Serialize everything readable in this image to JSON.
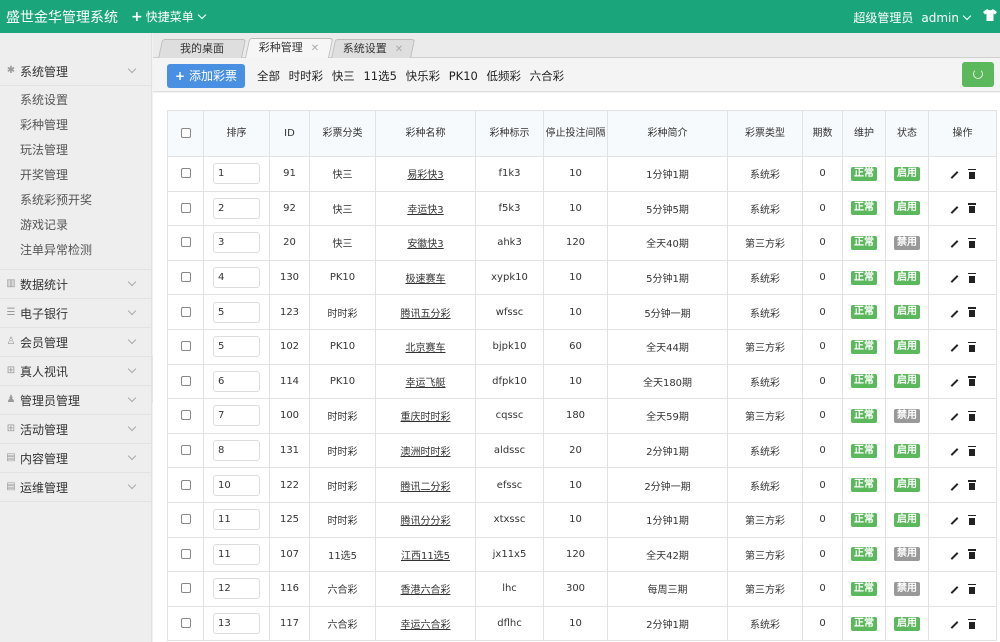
{
  "app": {
    "title": "盛世金华管理系统",
    "quick_menu": "快捷菜单",
    "user_role": "超级管理员",
    "user_name": "admin",
    "theme_icon": "shirt-icon",
    "accent_color": "#1aa67a"
  },
  "sidebar": {
    "groups": [
      {
        "label": "系统管理",
        "icon": "gear-icon",
        "expanded": true,
        "items": [
          "系统设置",
          "彩种管理",
          "玩法管理",
          "开奖管理",
          "系统彩预开奖",
          "游戏记录",
          "注单异常检测"
        ]
      },
      {
        "label": "数据统计",
        "icon": "chart-icon"
      },
      {
        "label": "电子银行",
        "icon": "list-icon"
      },
      {
        "label": "会员管理",
        "icon": "user-icon"
      },
      {
        "label": "真人视讯",
        "icon": "gift-icon"
      },
      {
        "label": "管理员管理",
        "icon": "admin-icon"
      },
      {
        "label": "活动管理",
        "icon": "gift-icon"
      },
      {
        "label": "内容管理",
        "icon": "content-icon"
      },
      {
        "label": "运维管理",
        "icon": "content-icon"
      }
    ]
  },
  "tabs": [
    {
      "label": "我的桌面",
      "closable": false,
      "active": false
    },
    {
      "label": "彩种管理",
      "closable": true,
      "active": true
    },
    {
      "label": "系统设置",
      "closable": true,
      "active": false
    }
  ],
  "toolbar": {
    "add_label": "添加彩票",
    "filters": [
      "全部",
      "时时彩",
      "快三",
      "11选5",
      "快乐彩",
      "PK10",
      "低频彩",
      "六合彩"
    ],
    "refresh_icon": "refresh-icon"
  },
  "table": {
    "headers": [
      "",
      "排序",
      "ID",
      "彩票分类",
      "彩种名称",
      "彩种标示",
      "停止投注间隔",
      "彩种简介",
      "彩票类型",
      "期数",
      "维护",
      "状态",
      "操作"
    ],
    "rows": [
      {
        "sort": "1",
        "id": "91",
        "category": "快三",
        "name": "易彩快3",
        "code": "f1k3",
        "interval": "10",
        "intro": "1分钟1期",
        "type": "系统彩",
        "periods": "0",
        "maintain": "正常",
        "status": "启用"
      },
      {
        "sort": "2",
        "id": "92",
        "category": "快三",
        "name": "幸运快3",
        "code": "f5k3",
        "interval": "10",
        "intro": "5分钟5期",
        "type": "系统彩",
        "periods": "0",
        "maintain": "正常",
        "status": "启用"
      },
      {
        "sort": "3",
        "id": "20",
        "category": "快三",
        "name": "安徽快3",
        "code": "ahk3",
        "interval": "120",
        "intro": "全天40期",
        "type": "第三方彩",
        "periods": "0",
        "maintain": "正常",
        "status": "禁用"
      },
      {
        "sort": "4",
        "id": "130",
        "category": "PK10",
        "name": "极速赛车",
        "code": "xypk10",
        "interval": "10",
        "intro": "5分钟1期",
        "type": "系统彩",
        "periods": "0",
        "maintain": "正常",
        "status": "启用"
      },
      {
        "sort": "5",
        "id": "123",
        "category": "时时彩",
        "name": "腾讯五分彩",
        "code": "wfssc",
        "interval": "10",
        "intro": "5分钟一期",
        "type": "系统彩",
        "periods": "0",
        "maintain": "正常",
        "status": "启用"
      },
      {
        "sort": "5",
        "id": "102",
        "category": "PK10",
        "name": "北京赛车",
        "code": "bjpk10",
        "interval": "60",
        "intro": "全天44期",
        "type": "第三方彩",
        "periods": "0",
        "maintain": "正常",
        "status": "启用"
      },
      {
        "sort": "6",
        "id": "114",
        "category": "PK10",
        "name": "幸运飞艇",
        "code": "dfpk10",
        "interval": "10",
        "intro": "全天180期",
        "type": "系统彩",
        "periods": "0",
        "maintain": "正常",
        "status": "启用"
      },
      {
        "sort": "7",
        "id": "100",
        "category": "时时彩",
        "name": "重庆时时彩",
        "code": "cqssc",
        "interval": "180",
        "intro": "全天59期",
        "type": "第三方彩",
        "periods": "0",
        "maintain": "正常",
        "status": "禁用"
      },
      {
        "sort": "8",
        "id": "131",
        "category": "时时彩",
        "name": "澳洲时时彩",
        "code": "aldssc",
        "interval": "20",
        "intro": "2分钟1期",
        "type": "系统彩",
        "periods": "0",
        "maintain": "正常",
        "status": "启用"
      },
      {
        "sort": "10",
        "id": "122",
        "category": "时时彩",
        "name": "腾讯二分彩",
        "code": "efssc",
        "interval": "10",
        "intro": "2分钟一期",
        "type": "系统彩",
        "periods": "0",
        "maintain": "正常",
        "status": "启用"
      },
      {
        "sort": "11",
        "id": "125",
        "category": "时时彩",
        "name": "腾讯分分彩",
        "code": "xtxssc",
        "interval": "10",
        "intro": "1分钟1期",
        "type": "第三方彩",
        "periods": "0",
        "maintain": "正常",
        "status": "启用"
      },
      {
        "sort": "11",
        "id": "107",
        "category": "11选5",
        "name": "江西11选5",
        "code": "jx11x5",
        "interval": "120",
        "intro": "全天42期",
        "type": "第三方彩",
        "periods": "0",
        "maintain": "正常",
        "status": "禁用"
      },
      {
        "sort": "12",
        "id": "116",
        "category": "六合彩",
        "name": "香港六合彩",
        "code": "lhc",
        "interval": "300",
        "intro": "每周三期",
        "type": "第三方彩",
        "periods": "0",
        "maintain": "正常",
        "status": "禁用"
      },
      {
        "sort": "13",
        "id": "117",
        "category": "六合彩",
        "name": "幸运六合彩",
        "code": "dflhc",
        "interval": "10",
        "intro": "2分钟1期",
        "type": "系统彩",
        "periods": "0",
        "maintain": "正常",
        "status": "启用"
      }
    ],
    "status_colors": {
      "enabled": "#5cb85c",
      "disabled": "#999999"
    }
  }
}
